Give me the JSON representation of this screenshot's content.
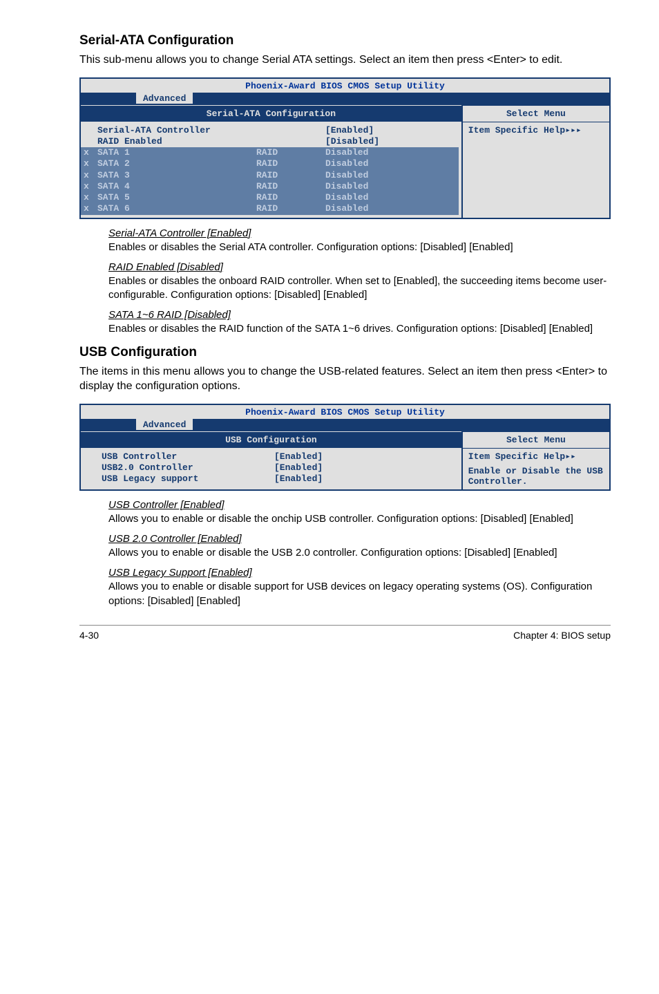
{
  "section1": {
    "heading": "Serial-ATA Configuration",
    "intro": "This sub-menu allows you to change Serial ATA settings. Select an item then press <Enter> to edit."
  },
  "bios1": {
    "title": "Phoenix-Award BIOS CMOS Setup Utility",
    "tab": "Advanced",
    "subtitle_left": "Serial-ATA Configuration",
    "subtitle_right": "Select Menu",
    "help_label": "Item Specific Help▸▸▸",
    "rows": [
      {
        "mk": "",
        "c1": "Serial-ATA Controller",
        "c2": "",
        "c3": "[Enabled]",
        "dis": false
      },
      {
        "mk": "",
        "c1": "RAID Enabled",
        "c2": "",
        "c3": "[Disabled]",
        "dis": false
      },
      {
        "mk": "x",
        "c1": "SATA 1",
        "c2": "RAID",
        "c3": "Disabled",
        "dis": true
      },
      {
        "mk": "x",
        "c1": "SATA 2",
        "c2": "RAID",
        "c3": "Disabled",
        "dis": true
      },
      {
        "mk": "x",
        "c1": "SATA 3",
        "c2": "RAID",
        "c3": "Disabled",
        "dis": true
      },
      {
        "mk": "x",
        "c1": "SATA 4",
        "c2": "RAID",
        "c3": "Disabled",
        "dis": true
      },
      {
        "mk": "x",
        "c1": "SATA 5",
        "c2": "RAID",
        "c3": "Disabled",
        "dis": true
      },
      {
        "mk": "x",
        "c1": "SATA 6",
        "c2": "RAID",
        "c3": "Disabled",
        "dis": true
      }
    ]
  },
  "notes1": [
    {
      "title": "Serial-ATA Controller [Enabled]",
      "body": "Enables or disables the Serial ATA controller. Configuration options: [Disabled] [Enabled]"
    },
    {
      "title": "RAID Enabled [Disabled]",
      "body": "Enables or disables the onboard RAID controller. When set to [Enabled], the succeeding items become user-configurable. Configuration options: [Disabled] [Enabled]"
    },
    {
      "title": "SATA 1~6 RAID [Disabled]",
      "body": "Enables or disables the RAID function of the SATA 1~6 drives. Configuration options: [Disabled] [Enabled]"
    }
  ],
  "section2": {
    "heading": "USB Configuration",
    "intro": "The items in this menu allows you to change the USB-related features. Select an item then press <Enter> to display the configuration options."
  },
  "bios2": {
    "title": "Phoenix-Award BIOS CMOS Setup Utility",
    "tab": "Advanced",
    "subtitle_left": "USB Configuration",
    "subtitle_right": "Select Menu",
    "help1": "Item Specific Help▸▸",
    "help2": "Enable or Disable the USB Controller.",
    "rows": [
      {
        "u1": "USB Controller",
        "u2": "[Enabled]"
      },
      {
        "u1": "USB2.0 Controller",
        "u2": "[Enabled]"
      },
      {
        "u1": "USB Legacy support",
        "u2": "[Enabled]"
      }
    ]
  },
  "notes2": [
    {
      "title": "USB Controller [Enabled]",
      "body": "Allows you to enable or disable the onchip USB controller. Configuration options: [Disabled] [Enabled]"
    },
    {
      "title": "USB 2.0 Controller [Enabled]",
      "body": "Allows you to enable or disable the USB 2.0 controller. Configuration options: [Disabled] [Enabled]"
    },
    {
      "title": "USB Legacy Support [Enabled]",
      "body": "Allows you to enable or disable support for USB devices on legacy operating systems (OS). Configuration options: [Disabled] [Enabled]"
    }
  ],
  "footer": {
    "left": "4-30",
    "right": "Chapter 4: BIOS setup"
  }
}
